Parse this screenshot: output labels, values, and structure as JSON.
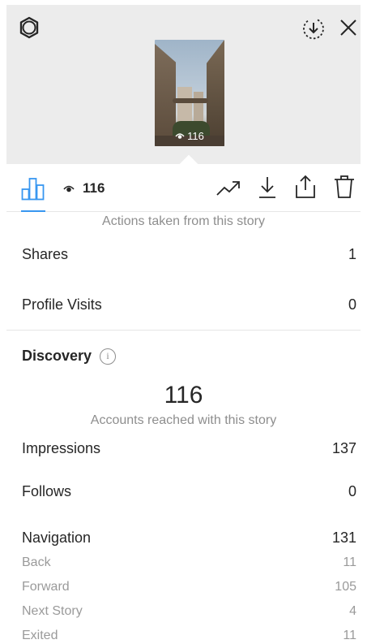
{
  "story": {
    "view_count": "116"
  },
  "toolbar": {
    "view_count": "116"
  },
  "actions": {
    "heading": "Actions taken from this story",
    "rows": [
      {
        "label": "Shares",
        "value": "1"
      },
      {
        "label": "Profile Visits",
        "value": "0"
      }
    ]
  },
  "discovery": {
    "title": "Discovery",
    "info": "i",
    "accounts_reached": "116",
    "accounts_reached_label": "Accounts reached with this story",
    "rows": [
      {
        "label": "Impressions",
        "value": "137"
      },
      {
        "label": "Follows",
        "value": "0"
      },
      {
        "label": "Navigation",
        "value": "131"
      }
    ],
    "navigation_details": [
      {
        "label": "Back",
        "value": "11"
      },
      {
        "label": "Forward",
        "value": "105"
      },
      {
        "label": "Next Story",
        "value": "4"
      },
      {
        "label": "Exited",
        "value": "11"
      }
    ]
  },
  "colors": {
    "accent": "#3897f0",
    "secondary_text": "#8e8e8e",
    "top_background": "#ececec"
  }
}
